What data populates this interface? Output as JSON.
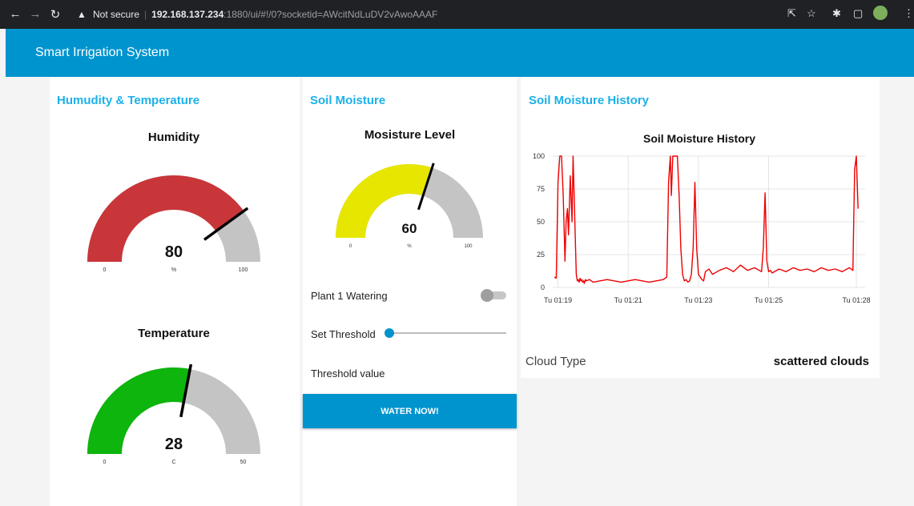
{
  "browser": {
    "security_label": "Not secure",
    "url_host": "192.168.137.234",
    "url_rest": ":1880/ui/#!/0?socketid=AWcitNdLuDV2vAwoAAAF"
  },
  "app": {
    "title": "Smart Irrigation System"
  },
  "humidity_temp": {
    "card_title": "Humudity & Temperature",
    "humidity": {
      "title": "Humidity",
      "value": "80",
      "unit": "%",
      "min": "0",
      "max": "100",
      "level": 0.8,
      "color": "#c8363a"
    },
    "temperature": {
      "title": "Temperature",
      "value": "28",
      "unit": "C",
      "min": "0",
      "max": "50",
      "level": 0.56,
      "color": "#0db50d"
    }
  },
  "soil": {
    "card_title": "Soil Moisture",
    "moisture": {
      "title": "Mosisture Level",
      "value": "60",
      "unit": "%",
      "min": "0",
      "max": "100",
      "level": 0.6,
      "color": "#e6e600"
    },
    "watering_label": "Plant 1 Watering",
    "threshold_label": "Set Threshold",
    "threshold_value_label": "Threshold value",
    "water_button": "WATER NOW!"
  },
  "history": {
    "card_title": "Soil Moisture History",
    "cloud_type_label": "Cloud Type",
    "cloud_type_value": "scattered clouds"
  },
  "chart_data": {
    "type": "line",
    "title": "Soil Moisture History",
    "xlabel": "",
    "ylabel": "",
    "ylim": [
      0,
      100
    ],
    "yticks": [
      0,
      25,
      50,
      75,
      100
    ],
    "xticks": [
      "Tu 01:19",
      "Tu 01:21",
      "Tu 01:23",
      "Tu 01:25",
      "Tu 01:28"
    ],
    "xtick_minutes": [
      0,
      2,
      4,
      6,
      8.5
    ],
    "xlim": [
      -0.15,
      8.75
    ],
    "grid": true,
    "series": [
      {
        "color": "#ee0000",
        "x": [
          -0.1,
          -0.05,
          0,
          0.05,
          0.1,
          0.15,
          0.2,
          0.23,
          0.27,
          0.3,
          0.35,
          0.4,
          0.43,
          0.47,
          0.5,
          0.52,
          0.55,
          0.58,
          0.6,
          0.63,
          0.65,
          0.68,
          0.7,
          0.73,
          0.75,
          0.78,
          0.8,
          0.9,
          1.0,
          1.2,
          1.4,
          1.6,
          1.8,
          2.0,
          2.2,
          2.4,
          2.6,
          2.8,
          3.0,
          3.1,
          3.15,
          3.2,
          3.23,
          3.27,
          3.3,
          3.4,
          3.45,
          3.5,
          3.55,
          3.6,
          3.65,
          3.7,
          3.75,
          3.8,
          3.85,
          3.9,
          3.95,
          4.0,
          4.05,
          4.1,
          4.15,
          4.2,
          4.3,
          4.4,
          4.6,
          4.8,
          5.0,
          5.2,
          5.4,
          5.6,
          5.8,
          5.85,
          5.9,
          5.95,
          6.0,
          6.05,
          6.1,
          6.3,
          6.5,
          6.7,
          6.9,
          7.1,
          7.3,
          7.5,
          7.7,
          7.9,
          8.1,
          8.3,
          8.4,
          8.45,
          8.5,
          8.55
        ],
        "y": [
          8,
          7,
          80,
          100,
          100,
          70,
          20,
          50,
          60,
          40,
          85,
          50,
          100,
          60,
          30,
          10,
          5,
          6,
          4,
          7,
          5,
          6,
          4,
          5,
          3,
          6,
          5,
          6,
          4,
          5,
          6,
          5,
          4,
          5,
          6,
          5,
          4,
          5,
          6,
          8,
          80,
          100,
          70,
          100,
          100,
          100,
          70,
          30,
          10,
          5,
          6,
          4,
          5,
          10,
          30,
          80,
          30,
          10,
          8,
          6,
          5,
          12,
          14,
          10,
          13,
          15,
          12,
          17,
          13,
          15,
          12,
          30,
          72,
          20,
          12,
          13,
          11,
          14,
          12,
          15,
          13,
          14,
          12,
          15,
          13,
          14,
          12,
          15,
          13,
          90,
          100,
          60
        ]
      }
    ]
  }
}
